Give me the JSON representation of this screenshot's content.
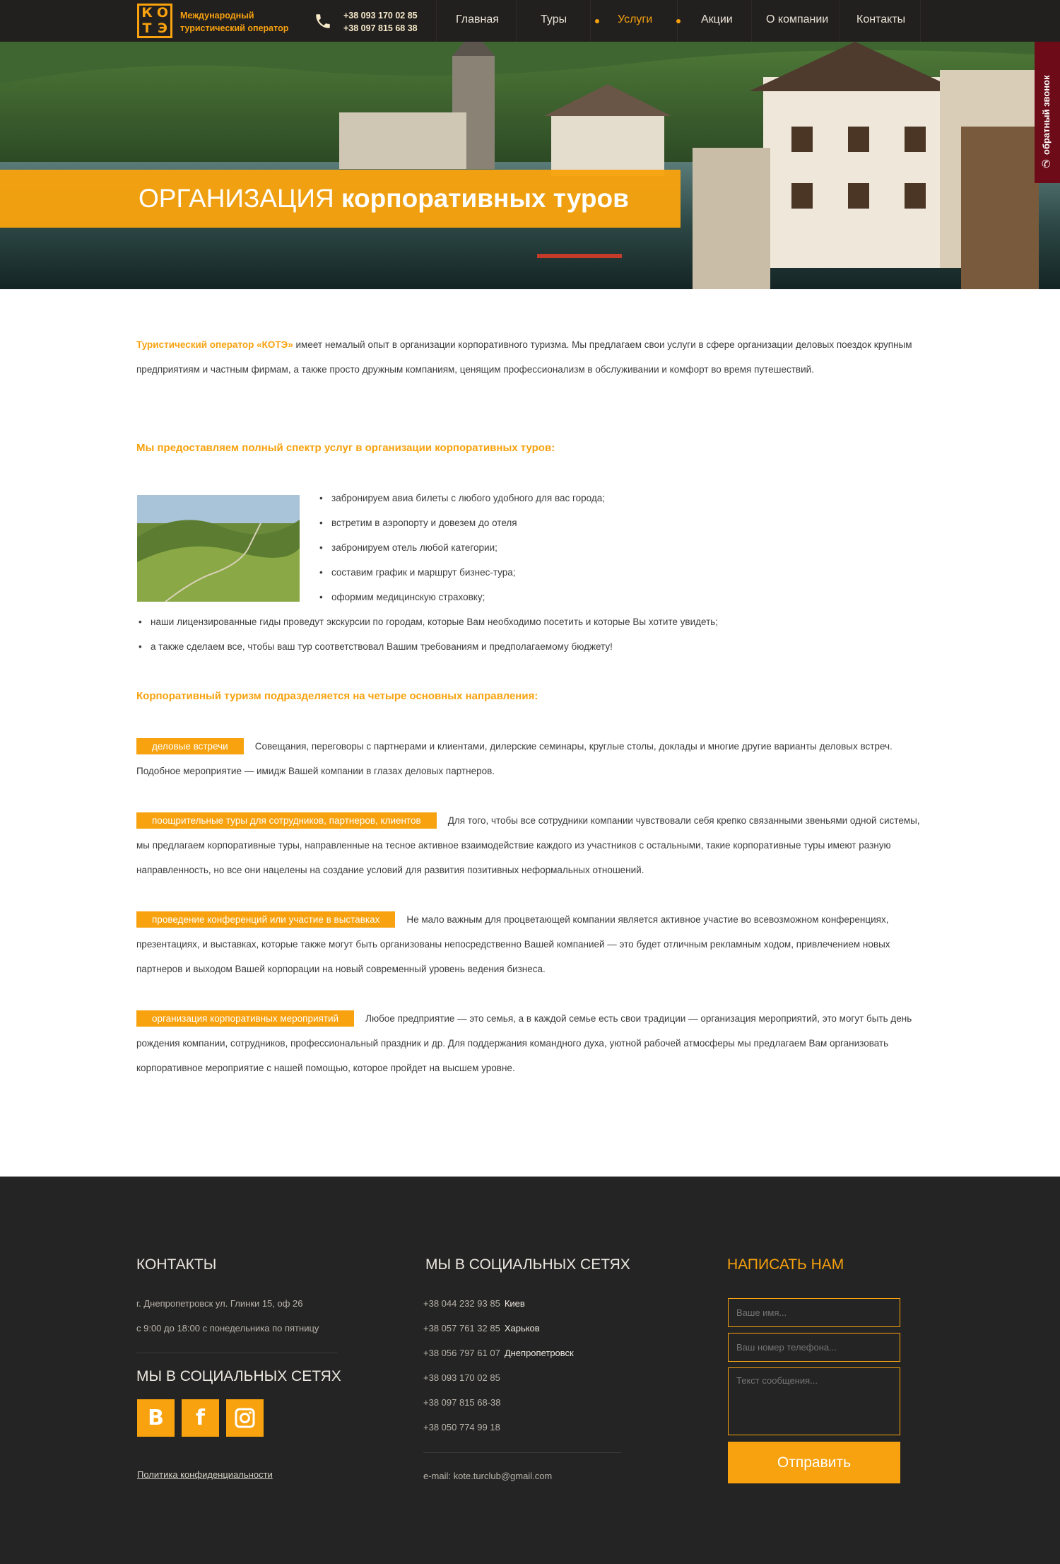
{
  "header": {
    "logo_letters": [
      "К",
      "О",
      "Т",
      "Э"
    ],
    "logo_line1": "Международный",
    "logo_line2": "туристический оператор",
    "phone1": "+38 093 170 02 85",
    "phone2": "+38 097 815 68 38",
    "nav": [
      "Главная",
      "Туры",
      "Услуги",
      "Акции",
      "О компании",
      "Контакты"
    ],
    "active_nav": "Услуги"
  },
  "hero": {
    "title_light": "ОРГАНИЗАЦИЯ",
    "title_bold": "корпоративных туров",
    "callback_label": "обратный звонок"
  },
  "intro": {
    "accent": "Туристический оператор «КОТЭ»",
    "text": " имеет немалый опыт в организации корпоративного туризма. Мы предлагаем свои услуги в сфере организации деловых поездок крупным предприятиям и частным фирмам, а также просто дружным компаниям, ценящим профессионализм в обслуживании и комфорт во время путешествий."
  },
  "services": {
    "heading": "Мы предоставляем полный спектр услуг в организации корпоративных туров:",
    "items": [
      "забронируем авиа билеты с любого удобного для вас города;",
      "встретим в аэропорту и довезем до отеля",
      "забронируем отель любой категории;",
      "составим график и маршрут бизнес-тура;",
      "оформим медицинскую страховку;",
      "наши лицензированные гиды проведут экскурсии по городам, которые Вам необходимо посетить и которые Вы хотите увидеть;",
      "а также сделаем все, чтобы ваш тур соответствовал Вашим требованиям и предполагаемому бюджету!"
    ]
  },
  "directions": {
    "heading": "Корпоративный туризм подразделяется на четыре основных направления:",
    "items": [
      {
        "tag": "деловые встречи",
        "text": "Совещания, переговоры с партнерами и клиентами, дилерские семинары, круглые столы, доклады и многие другие варианты деловых встреч. Подобное мероприятие — имидж Вашей компании в глазах деловых партнеров."
      },
      {
        "tag": "поощрительные туры для сотрудников, партнеров, клиентов",
        "text": "Для того, чтобы все сотрудники компании чувствовали себя крепко связанными звеньями одной системы, мы предлагаем корпоративные туры, направленные на тесное активное взаимодействие каждого из участников с остальными, такие корпоративные туры имеют разную направленность, но все они нацелены на создание условий для развития позитивных неформальных отношений."
      },
      {
        "tag": "проведение конференций или участие в выставках",
        "text": "Не мало важным для процветающей компании является активное участие во всевозможном конференциях, презентациях, и выставках, которые также могут быть организованы непосредственно Вашей компанией — это будет отличным рекламным ходом, привлечением новых партнеров и выходом Вашей корпорации на новый современный уровень ведения бизнеса."
      },
      {
        "tag": "организация корпоративных мероприятий",
        "text": "Любое предприятие — это семья, а в каждой семье есть свои традиции — организация мероприятий, это могут быть день рождения компании, сотрудников, профессиональный праздник и др.  Для поддержания командного духа, уютной рабочей атмосферы мы предлагаем Вам организовать корпоративное мероприятие с нашей помощью, которое пройдет на высшем уровне."
      }
    ]
  },
  "footer": {
    "contacts_heading": "КОНТАКТЫ",
    "address": "г. Днепропетровск ул. Глинки 15, оф 26",
    "hours": "с 9:00 до 18:00 с понедельника по пятницу",
    "social_heading_left": "МЫ В СОЦИАЛЬНЫХ СЕТЯХ",
    "social_icons": [
      "В",
      "f",
      "instagram-icon"
    ],
    "policy": "Политика конфиденциальности",
    "social_heading_mid": "МЫ В СОЦИАЛЬНЫХ СЕТЯХ",
    "phones": [
      {
        "number": "+38 044 232 93 85",
        "city": "Киев"
      },
      {
        "number": "+38 057 761 32 85",
        "city": "Харьков"
      },
      {
        "number": "+38 056 797 61 07",
        "city": "Днепропетровск"
      },
      {
        "number": "+38 093 170 02 85",
        "city": ""
      },
      {
        "number": "+38 097 815 68-38",
        "city": ""
      },
      {
        "number": "+38 050 774 99 18",
        "city": ""
      }
    ],
    "email": "e-mail: kote.turclub@gmail.com",
    "write_heading": "НАПИСАТЬ НАМ",
    "name_placeholder": "Ваше имя...",
    "phone_placeholder": "Ваш номер телефона...",
    "message_placeholder": "Текст сообщения...",
    "send_label": "Отправить"
  },
  "colors": {
    "accent": "#f7a20e",
    "header_bg": "#221f1f",
    "footer_bg": "#242424",
    "callback_bg": "#6d0c18"
  }
}
